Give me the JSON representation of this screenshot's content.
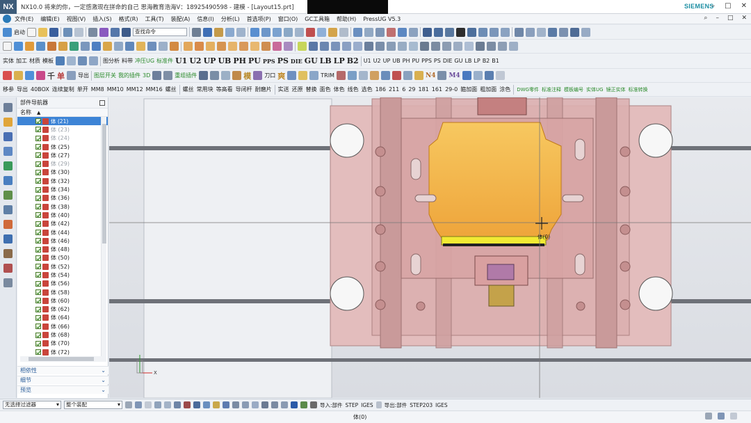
{
  "window": {
    "title": "NX10.0 将来的你，一定感激现在拼命的自己 思海教育浩海V：18925490598 - 建模 - [Layout15.prt]",
    "logo_text": "NX",
    "brand": "SIEMENS",
    "controls": [
      "–",
      "□",
      "✕"
    ]
  },
  "menu": {
    "items": [
      "文件(E)",
      "编辑(E)",
      "视图(V)",
      "插入(S)",
      "格式(R)",
      "工具(T)",
      "装配(A)",
      "信息(I)",
      "分析(L)",
      "首选项(P)",
      "窗口(O)",
      "GC工具箱",
      "帮助(H)",
      "PressUG V5.3"
    ],
    "right": [
      "⌕",
      "–",
      "□",
      "✕"
    ]
  },
  "toolbar1": {
    "start_label": "启动",
    "search_placeholder": "查找命令"
  },
  "toolbar3": {
    "left_labels": [
      "实体",
      "加工",
      "材质",
      "模板"
    ],
    "labels": [
      "图分析",
      "料带",
      "冲压UG",
      "标准件"
    ],
    "big": [
      "U1",
      "U2",
      "UP",
      "UB",
      "PH",
      "PU",
      "PPS",
      "PS",
      "DIE",
      "GU",
      "LB",
      "LP",
      "B2"
    ],
    "big_right": [
      "U1",
      "U2",
      "UP",
      "UB",
      "PH",
      "PU",
      "PPS",
      "PS",
      "DIE",
      "GU",
      "LB",
      "LP",
      "B2",
      "B1"
    ]
  },
  "toolbar4": {
    "chars": [
      "千",
      "单"
    ],
    "labels": [
      "导出",
      "图层开关",
      "我的插件",
      "3D",
      "重组插件"
    ],
    "more": [
      "模",
      "刀口",
      "爽"
    ],
    "right_labels": [
      "TRIM",
      "N4",
      "M4"
    ]
  },
  "toolbar5": {
    "items": [
      "移参",
      "导出",
      "40BOX",
      "连续复制",
      "单开",
      "MM8",
      "MM10",
      "MM12",
      "MM16",
      "螺丝",
      "螺丝",
      "常用块",
      "等高看",
      "导闭杆",
      "耐磨片",
      "实送",
      "还原",
      "替换",
      "面色",
      "体色",
      "线色",
      "选色",
      "186",
      "211",
      "6",
      "29",
      "181",
      "161",
      "29-0",
      "箍加面",
      "粗加面",
      "涂色"
    ],
    "stacked": [
      "DWG零件",
      "标准注释",
      "模板编号",
      "实体UG",
      "镜正实体",
      "标准转换"
    ]
  },
  "navigator": {
    "title": "部件导航器",
    "column": "名称",
    "rows": [
      {
        "label": "体 (21)",
        "state": "selected"
      },
      {
        "label": "体 (23)",
        "state": "dim"
      },
      {
        "label": "体 (24)",
        "state": "dim"
      },
      {
        "label": "体 (25)",
        "state": "normal"
      },
      {
        "label": "体 (27)",
        "state": "normal"
      },
      {
        "label": "体 (29)",
        "state": "dim"
      },
      {
        "label": "体 (30)",
        "state": "normal"
      },
      {
        "label": "体 (32)",
        "state": "normal"
      },
      {
        "label": "体 (34)",
        "state": "normal"
      },
      {
        "label": "体 (36)",
        "state": "normal"
      },
      {
        "label": "体 (38)",
        "state": "normal"
      },
      {
        "label": "体 (40)",
        "state": "normal"
      },
      {
        "label": "体 (42)",
        "state": "normal"
      },
      {
        "label": "体 (44)",
        "state": "normal"
      },
      {
        "label": "体 (46)",
        "state": "normal"
      },
      {
        "label": "体 (48)",
        "state": "normal"
      },
      {
        "label": "体 (50)",
        "state": "normal"
      },
      {
        "label": "体 (52)",
        "state": "normal"
      },
      {
        "label": "体 (54)",
        "state": "normal"
      },
      {
        "label": "体 (56)",
        "state": "normal"
      },
      {
        "label": "体 (58)",
        "state": "normal"
      },
      {
        "label": "体 (60)",
        "state": "normal"
      },
      {
        "label": "体 (62)",
        "state": "normal"
      },
      {
        "label": "体 (64)",
        "state": "normal"
      },
      {
        "label": "体 (66)",
        "state": "normal"
      },
      {
        "label": "体 (68)",
        "state": "normal"
      },
      {
        "label": "体 (70)",
        "state": "normal"
      },
      {
        "label": "体 (72)",
        "state": "normal"
      }
    ],
    "sections": [
      "相依性",
      "细节",
      "预览"
    ]
  },
  "viewport": {
    "cursor_label": "体(0)",
    "axis_x": "X",
    "colors": {
      "plate": "#e2bcbc",
      "plate_edge": "#a98080",
      "part": "#f3b23a",
      "part_light": "#f6d27c",
      "yellow": "#f2ea33"
    }
  },
  "statusbar": {
    "filter": "无选择过滤器",
    "scope": "整个装配",
    "import_label": "导入:部件",
    "step": "STEP",
    "iges": "IGES",
    "export_label": "导出:部件",
    "step203": "STEP203",
    "iges2": "IGES"
  },
  "bottom": {
    "text": "体(0)"
  }
}
